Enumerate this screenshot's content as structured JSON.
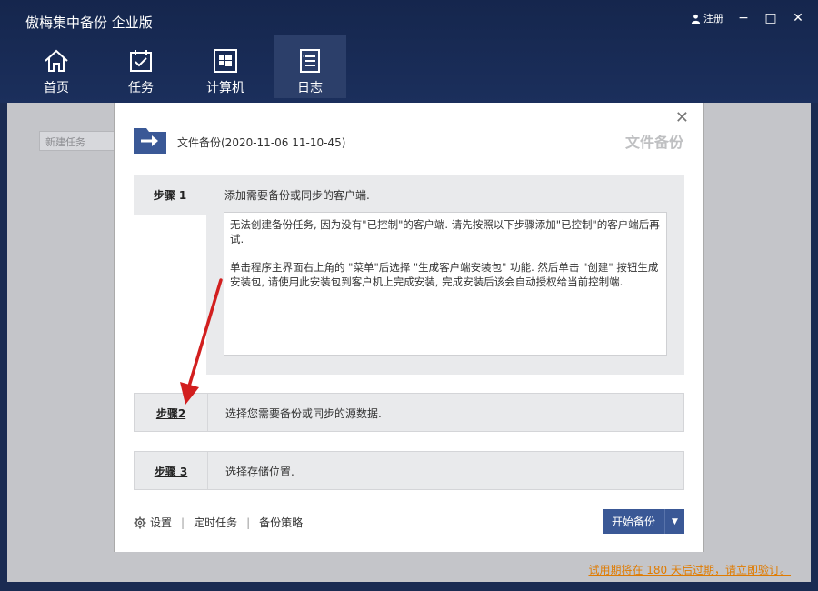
{
  "window": {
    "title": "傲梅集中备份 企业版",
    "register_label": "注册",
    "minimize": "−",
    "maximize": "□",
    "close": "✕"
  },
  "nav": {
    "items": [
      {
        "label": "首页",
        "icon": "home-icon"
      },
      {
        "label": "任务",
        "icon": "task-icon"
      },
      {
        "label": "计算机",
        "icon": "computer-icon"
      },
      {
        "label": "日志",
        "icon": "log-icon",
        "active": true
      }
    ]
  },
  "background": {
    "new_task_label": "新建任务"
  },
  "dialog": {
    "close": "✕",
    "subtitle": "文件备份(2020-11-06 11-10-45)",
    "title_right": "文件备份",
    "step1": {
      "label": "步骤 1",
      "desc": "添加需要备份或同步的客户端.",
      "message_p1": "无法创建备份任务, 因为没有\"已控制\"的客户端. 请先按照以下步骤添加\"已控制\"的客户端后再试.",
      "message_p2": "单击程序主界面右上角的 \"菜单\"后选择 \"生成客户端安装包\" 功能. 然后单击 \"创建\" 按钮生成安装包, 请使用此安装包到客户机上完成安装, 完成安装后该会自动授权给当前控制端."
    },
    "step2": {
      "label": "步骤2",
      "desc": "选择您需要备份或同步的源数据."
    },
    "step3": {
      "label": "步骤 3",
      "desc": "选择存储位置."
    },
    "footer": {
      "settings": "设置",
      "scheduled": "定时任务",
      "policy": "备份策略"
    },
    "start_button": "开始备份"
  },
  "trial_notice": "试用期将在 180 天后过期，请立即验订。",
  "colors": {
    "header": "#1b2f5c",
    "accent": "#3a5896",
    "arrow": "#d21f1f",
    "trial": "#e07b00"
  }
}
